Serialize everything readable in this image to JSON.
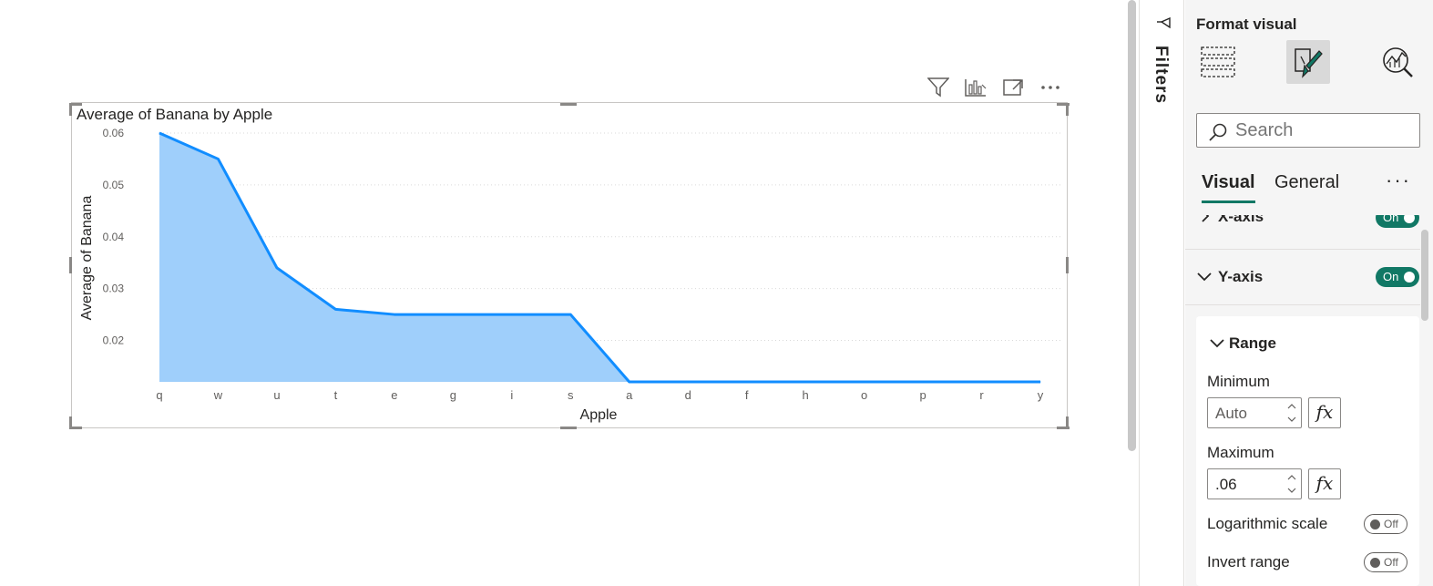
{
  "visual": {
    "header_icons": [
      "filter-icon",
      "drill-icon",
      "focus-mode-icon",
      "more-options-icon"
    ]
  },
  "chart_data": {
    "type": "area",
    "title": "Average of Banana by Apple",
    "xlabel": "Apple",
    "ylabel": "Average of Banana",
    "categories": [
      "q",
      "w",
      "u",
      "t",
      "e",
      "g",
      "i",
      "s",
      "a",
      "d",
      "f",
      "h",
      "o",
      "p",
      "r",
      "y"
    ],
    "values": [
      0.06,
      0.055,
      0.034,
      0.026,
      0.025,
      0.025,
      0.025,
      0.025,
      0.012,
      0.012,
      0.012,
      0.012,
      0.012,
      0.012,
      0.012,
      0.012
    ],
    "yticks": [
      "0.06",
      "0.05",
      "0.04",
      "0.03",
      "0.02"
    ],
    "ylim": [
      0.012,
      0.06
    ],
    "grid": true,
    "colors": {
      "line": "#118DFF",
      "fill": "#9FCFFB"
    }
  },
  "filters": {
    "label": "Filters"
  },
  "pane": {
    "title": "Format visual",
    "tools": [
      "build-visual-icon",
      "format-visual-icon",
      "analytics-icon"
    ],
    "search": {
      "placeholder": "Search"
    },
    "tabs": [
      "Visual",
      "General"
    ],
    "more": "···",
    "sections": {
      "xaxis": {
        "label": "X-axis",
        "toggle": "On"
      },
      "yaxis": {
        "label": "Y-axis",
        "toggle": "On"
      }
    },
    "range": {
      "label": "Range",
      "minimum_label": "Minimum",
      "minimum_value": "Auto",
      "maximum_label": "Maximum",
      "maximum_value": ".06",
      "fx": "fx",
      "log_label": "Logarithmic scale",
      "log_toggle": "Off",
      "invert_label": "Invert range",
      "invert_toggle": "Off"
    },
    "accent_color": "#117865"
  }
}
